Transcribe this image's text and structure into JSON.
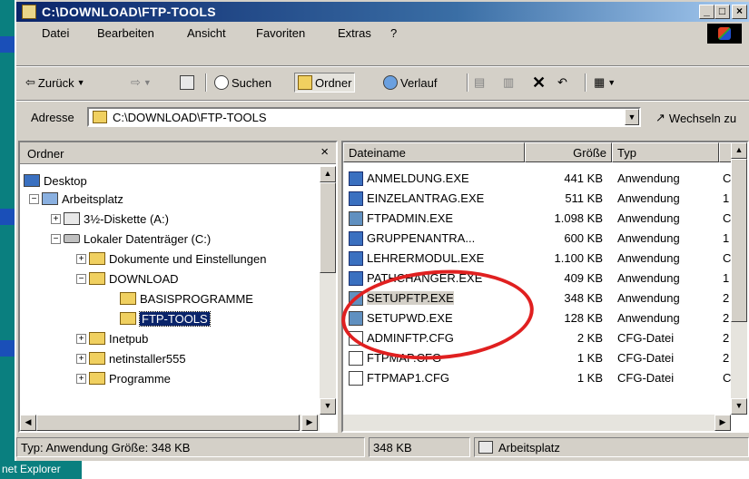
{
  "window": {
    "title": "C:\\DOWNLOAD\\FTP-TOOLS",
    "controls": [
      "_",
      "□",
      "×"
    ]
  },
  "menu": [
    "Datei",
    "Bearbeiten",
    "Ansicht",
    "Favoriten",
    "Extras",
    "?"
  ],
  "toolbar": {
    "back": "Zurück",
    "search": "Suchen",
    "folders": "Ordner",
    "history": "Verlauf"
  },
  "address": {
    "label": "Adresse",
    "value": "C:\\DOWNLOAD\\FTP-TOOLS",
    "go": "Wechseln zu"
  },
  "folder_pane": {
    "title": "Ordner",
    "close": "×",
    "tree": [
      {
        "label": "Desktop",
        "icon": "desktop-icon"
      },
      {
        "label": "Arbeitsplatz",
        "icon": "computer-icon"
      },
      {
        "label": "3½-Diskette (A:)",
        "icon": "floppy-icon"
      },
      {
        "label": "Lokaler Datenträger (C:)",
        "icon": "drive-icon"
      },
      {
        "label": "Dokumente und Einstellungen",
        "icon": "folder-icon"
      },
      {
        "label": "DOWNLOAD",
        "icon": "folder-icon"
      },
      {
        "label": "BASISPROGRAMME",
        "icon": "folder-icon"
      },
      {
        "label": "FTP-TOOLS",
        "icon": "folder-open-icon",
        "selected": true
      },
      {
        "label": "Inetpub",
        "icon": "folder-icon"
      },
      {
        "label": "netinstaller555",
        "icon": "folder-icon"
      },
      {
        "label": "Programme",
        "icon": "folder-icon"
      }
    ]
  },
  "file_list": {
    "columns": [
      "Dateiname",
      "Größe",
      "Typ"
    ],
    "files": [
      {
        "name": "ANMELDUNG.EXE",
        "size": "441 KB",
        "type": "Anwendung",
        "extra": "C"
      },
      {
        "name": "EINZELANTRAG.EXE",
        "size": "511 KB",
        "type": "Anwendung",
        "extra": "1"
      },
      {
        "name": "FTPADMIN.EXE",
        "size": "1.098 KB",
        "type": "Anwendung",
        "extra": "C"
      },
      {
        "name": "GRUPPENANTRA...",
        "size": "600 KB",
        "type": "Anwendung",
        "extra": "1"
      },
      {
        "name": "LEHRERMODUL.EXE",
        "size": "1.100 KB",
        "type": "Anwendung",
        "extra": "C"
      },
      {
        "name": "PATHCHANGER.EXE",
        "size": "409 KB",
        "type": "Anwendung",
        "extra": "1"
      },
      {
        "name": "SETUPFTP.EXE",
        "size": "348 KB",
        "type": "Anwendung",
        "extra": "2"
      },
      {
        "name": "SETUPWD.EXE",
        "size": "128 KB",
        "type": "Anwendung",
        "extra": "2"
      },
      {
        "name": "ADMINFTP.CFG",
        "size": "2 KB",
        "type": "CFG-Datei",
        "extra": "2"
      },
      {
        "name": "FTPMAP.CFG",
        "size": "1 KB",
        "type": "CFG-Datei",
        "extra": "2"
      },
      {
        "name": "FTPMAP1.CFG",
        "size": "1 KB",
        "type": "CFG-Datei",
        "extra": "C"
      }
    ]
  },
  "status": {
    "info": "Typ: Anwendung Größe: 348 KB",
    "size": "348 KB",
    "zone": "Arbeitsplatz"
  },
  "desktop": {
    "ie_label": "net Explorer"
  },
  "colors": {
    "title_start": "#0a246a",
    "title_end": "#a6caf0",
    "highlight_circle": "#e02020",
    "desktop": "#0a7f7f"
  }
}
